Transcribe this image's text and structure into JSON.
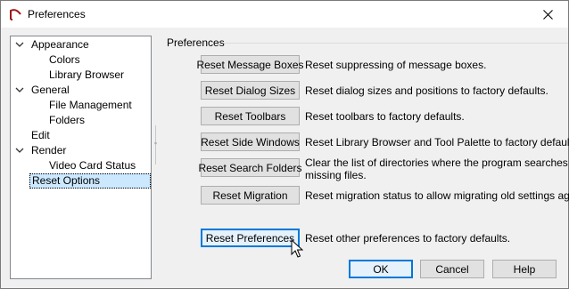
{
  "window": {
    "title": "Preferences"
  },
  "tree": {
    "items": [
      {
        "label": "Appearance",
        "level": 0,
        "expanded": true
      },
      {
        "label": "Colors",
        "level": 1
      },
      {
        "label": "Library Browser",
        "level": 1
      },
      {
        "label": "General",
        "level": 0,
        "expanded": true
      },
      {
        "label": "File Management",
        "level": 1
      },
      {
        "label": "Folders",
        "level": 1
      },
      {
        "label": "Edit",
        "level": 0
      },
      {
        "label": "Render",
        "level": 0,
        "expanded": true
      },
      {
        "label": "Video Card Status",
        "level": 1
      },
      {
        "label": "Reset Options",
        "level": 0,
        "selected": true
      }
    ]
  },
  "panel": {
    "group_title": "Preferences",
    "rows": [
      {
        "button": "Reset Message Boxes",
        "description": "Reset suppressing of message boxes."
      },
      {
        "button": "Reset Dialog Sizes",
        "description": "Reset dialog sizes and positions to factory defaults."
      },
      {
        "button": "Reset Toolbars",
        "description": "Reset toolbars to factory defaults."
      },
      {
        "button": "Reset Side Windows",
        "description": "Reset Library Browser and Tool Palette to factory defaults."
      },
      {
        "button": "Reset Search Folders",
        "description": "Clear the list of directories where the program searches for",
        "description2": "missing files."
      },
      {
        "button": "Reset Migration",
        "description": "Reset migration status to allow migrating old settings again."
      },
      {
        "button": "Reset Preferences",
        "description": "Reset other preferences to factory defaults."
      }
    ]
  },
  "footer": {
    "ok": "OK",
    "cancel": "Cancel",
    "help": "Help"
  },
  "colors": {
    "selection": "#cce8ff",
    "focus_border": "#0078d7",
    "button_face": "#e1e1e1"
  },
  "icons": {
    "app": "home-designer-icon",
    "close": "close-icon",
    "expand": "chevron-down-icon",
    "cursor": "mouse-pointer-icon"
  }
}
